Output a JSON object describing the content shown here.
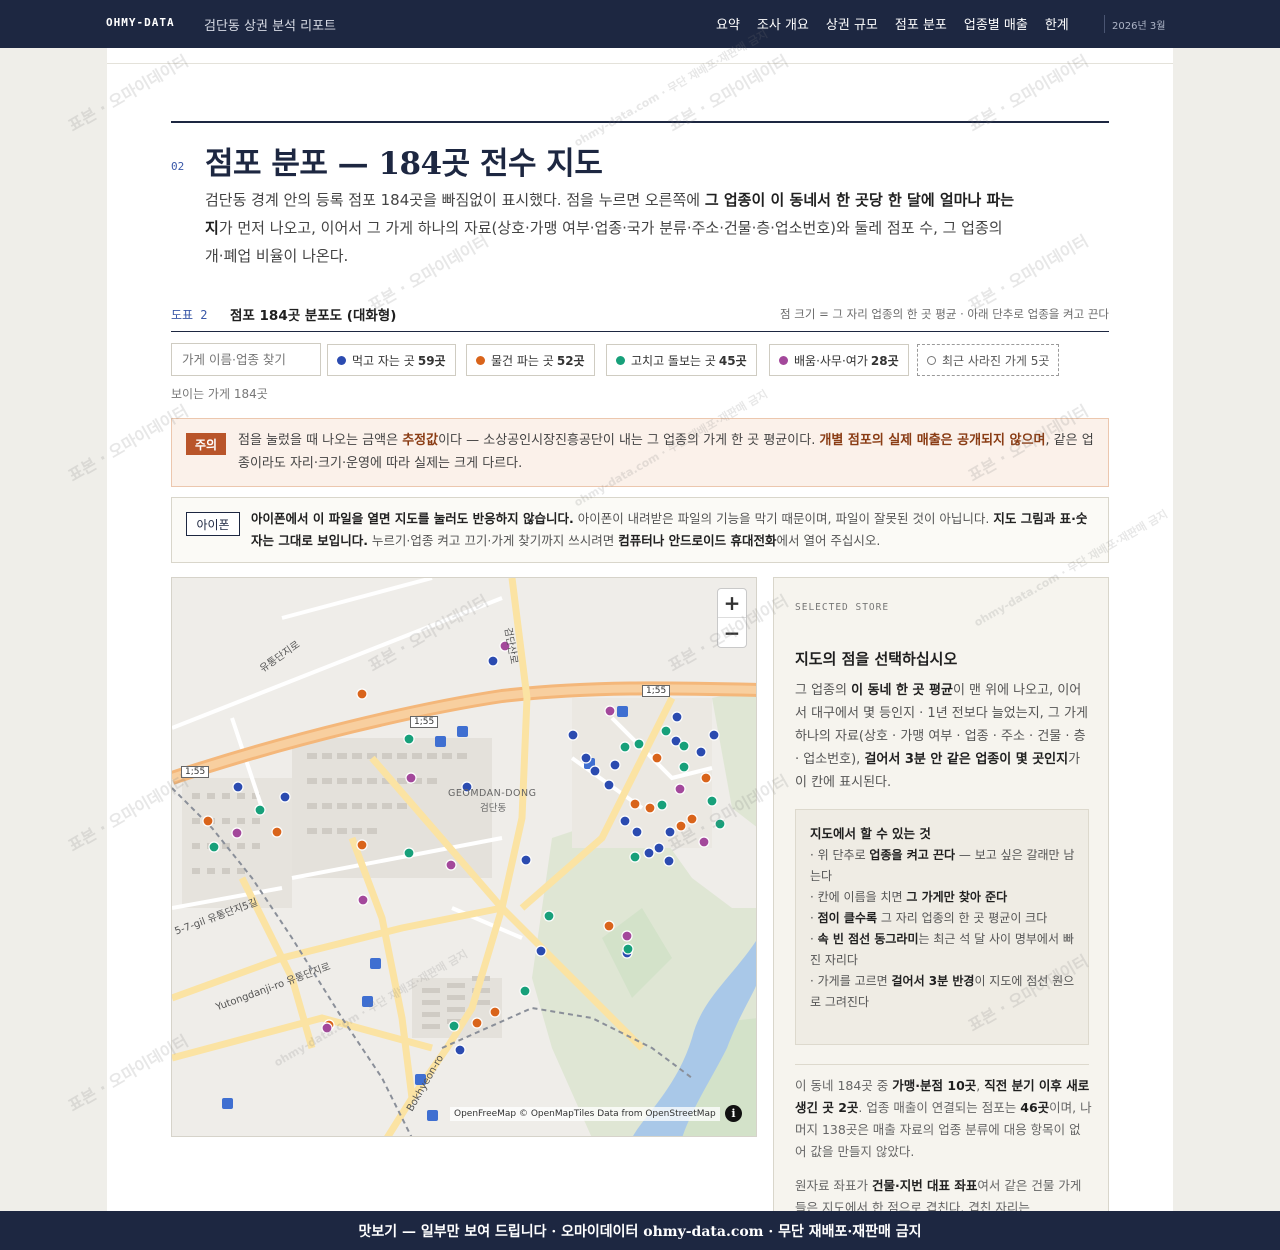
{
  "header": {
    "brand": "OHMY-DATA",
    "report_title": "검단동 상권 분석 리포트",
    "nav": [
      "요약",
      "조사 개요",
      "상권 규모",
      "점포 분포",
      "업종별 매출",
      "한계"
    ],
    "date": "2026년 3월"
  },
  "section": {
    "number": "02",
    "title": "점포 분포 — 184곳 전수 지도",
    "desc_a": "검단동 경계 안의 등록 점포 184곳을 빠짐없이 표시했다. 점을 누르면 오른쪽에 ",
    "desc_b": "그 업종이 이 동네서 한 곳당 한 달에 얼마나 파는지",
    "desc_c": "가 먼저 나오고, 이어서 그 가게 하나의 자료(상호·가맹 여부·업종·국가 분류·주소·건물·층·업소번호)와 둘레 점포 수, 그 업종의 개·폐업 비율이 나온다."
  },
  "figure": {
    "label": "도표 2",
    "title": "점포 184곳 분포도 (대화형)",
    "note": "점 크기 = 그 자리 업종의 한 곳 평균 · 아래 단추로 업종을 켜고 끈다"
  },
  "search": {
    "placeholder": "가게 이름·업종 찾기"
  },
  "filters": [
    {
      "label": "먹고 자는 곳",
      "count": "59곳",
      "color": "#2b4bb0"
    },
    {
      "label": "물건 파는 곳",
      "count": "52곳",
      "color": "#d9641b"
    },
    {
      "label": "고치고 돌보는 곳",
      "count": "45곳",
      "color": "#17a07a"
    },
    {
      "label": "배움·사무·여가",
      "count": "28곳",
      "color": "#a3489b"
    },
    {
      "label": "최근 사라진 가게 5곳",
      "count": "",
      "color": "#777777"
    }
  ],
  "visible_count": "보이는 가게 184곳",
  "warning": {
    "tag": "주의",
    "a": "점을 눌렀을 때 나오는 금액은 ",
    "b": "추정값",
    "c": "이다 — 소상공인시장진흥공단이 내는 그 업종의 가게 한 곳 평균이다. ",
    "d": "개별 점포의 실제 매출은 공개되지 않으며",
    "e": ", 같은 업종이라도 자리·크기·운영에 따라 실제는 크게 다르다."
  },
  "ios": {
    "tag": "아이폰",
    "a": "아이폰에서 이 파일을 열면 지도를 눌러도 반응하지 않습니다.",
    "b": " 아이폰이 내려받은 파일의 기능을 막기 때문이며, 파일이 잘못된 것이 아닙니다. ",
    "c": "지도 그림과 표·숫자는 그대로 보입니다.",
    "d": " 누르기·업종 켜고 끄기·가게 찾기까지 쓰시려면 ",
    "e": "컴퓨터나 안드로이드 휴대전화",
    "f": "에서 열어 주십시오."
  },
  "map": {
    "district_en": "GEOMDAN-DONG",
    "district_ko": "검단동",
    "zoom_in": "+",
    "zoom_out": "−",
    "attribution": "OpenFreeMap © OpenMapTiles Data from OpenStreetMap",
    "info": "i",
    "roads": [
      "유통단지로",
      "검단산로",
      "1;55",
      "유통단지로",
      "Yutongdanji-ro 유통단지로",
      "5-7-gil 유통단지5길",
      "Bokhyeon-ro"
    ]
  },
  "panel": {
    "eyebrow": "SELECTED STORE",
    "title": "지도의 점을 선택하십시오",
    "desc_a": "그 업종의 ",
    "desc_b": "이 동네 한 곳 평균",
    "desc_c": "이 맨 위에 나오고, 이어서 대구에서 몇 등인지 · 1년 전보다 늘었는지, 그 가게 하나의 자료(상호 · 가맹 여부 · 업종 · 주소 · 건물 · 층 · 업소번호), ",
    "desc_d": "걸어서 3분 안 같은 업종이 몇 곳인지",
    "desc_e": "가 이 칸에 표시된다.",
    "help_title": "지도에서 할 수 있는 것",
    "help": [
      {
        "a": "· 위 단추로 ",
        "b": "업종을 켜고 끈다",
        "c": " — 보고 싶은 갈래만 남는다"
      },
      {
        "a": "· 칸에 이름을 치면 ",
        "b": "그 가게만 찾아 준다",
        "c": ""
      },
      {
        "a": "· ",
        "b": "점이 클수록",
        "c": " 그 자리 업종의 한 곳 평균이 크다"
      },
      {
        "a": "· ",
        "b": "속 빈 점선 동그라미",
        "c": "는 최근 석 달 사이 명부에서 빠진 자리다"
      },
      {
        "a": "· 가게를 고르면 ",
        "b": "걸어서 3분 반경",
        "c": "이 지도에 점선 원으로 그려진다"
      }
    ],
    "note1_a": "이 동네 184곳 중 ",
    "note1_b": "가맹·분점 10곳",
    "note1_c": ", ",
    "note1_d": "직전 분기 이후 새로 생긴 곳 2곳",
    "note1_e": ". 업종 매출이 연결되는 점포는 ",
    "note1_f": "46곳",
    "note1_g": "이며, 나머지 138곳은 매출 자료의 업종 분류에 대응 항목이 없어 값을 만들지 않았다.",
    "note2_a": "원자료 좌표가 ",
    "note2_b": "건물·지번 대표 좌표",
    "note2_c": "여서 같은 건물 가게들은 지도에서 한 점으로 겹친다. 겹친 자리는"
  },
  "watermark": {
    "text": "표본 · 오마이데이터",
    "small": "ohmy-data.com · 무단 재배포·재판매 금지"
  },
  "footer": "맛보기 — 일부만 보여 드립니다 · 오마이데이터 ohmy-data.com · 무단 재배포·재판매 금지"
}
